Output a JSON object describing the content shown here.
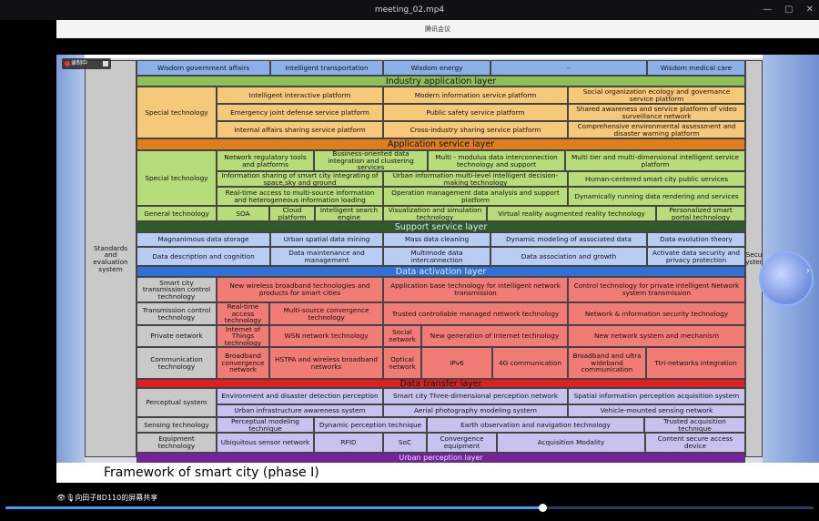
{
  "window": {
    "title": "meeting_02.mp4",
    "controls": [
      "—",
      "▢",
      "✕"
    ]
  },
  "meeting_bar": {
    "label": "腾讯会议"
  },
  "recording": {
    "label": "录制中"
  },
  "bottom": {
    "share_text": "👁🎙向田子BD110的屏幕共享"
  },
  "progress": {
    "value_fraction": 0.664
  },
  "caption": "Framework of smart city (phase I)",
  "colors": {
    "top_row": "#8ab0e8",
    "industry_layer": "#8ec05a",
    "industry_cell": "#f6c87a",
    "app_layer": "#e07e1d",
    "app_cell": "#b7dc7a",
    "support_layer": "#2f5a2a",
    "support_cell": "#b9cdf3",
    "activation_layer": "#2f71d5",
    "activation_cell": "#f07c75",
    "transfer_layer": "#e02020",
    "perception_cell": "#c7c3ee",
    "urban_layer": "#7a1fa0",
    "side_label": "#c9c9c9"
  },
  "slide": {
    "top_row": [
      "Wisdom government affairs",
      "Intelligent transportation",
      "Wisdom energy",
      "–",
      "Wisdom medical care"
    ],
    "side_label_left": "Standards and evaluation system",
    "side_label_right": "Secu system",
    "layers": {
      "industry": "Industry application layer",
      "app": "Application service layer",
      "support": "Support service layer",
      "activation": "Data activation layer",
      "transfer": "Data transfer layer",
      "urban": "Urban perception layer"
    },
    "industry": {
      "label": "Special technology",
      "rows": [
        [
          "Intelligent interactive platform",
          "Modern information service platform",
          "Social organization ecology and governance service platform"
        ],
        [
          "Emergency joint defense service platform",
          "Public safety service platform",
          "Shared awareness and service platform of video surveillance network"
        ],
        [
          "Internal affairs sharing service platform",
          "Cross-industry sharing service platform",
          "Comprehensive environmental assessment and disaster warning platform"
        ]
      ]
    },
    "app": {
      "special_label": "Special technology",
      "row1": [
        "Network regulatory tools and platforms",
        "Business-oriented data integration and clustering services",
        "Multi - modulus data interconnection technology and support",
        "Multi tier and multi-dimensional intelligent service platform"
      ],
      "row2": [
        "Information sharing of smart city integrating of space,sky and ground",
        "Urban information multi-level intelligent decision-making technology",
        "Human-centered smart city public services"
      ],
      "row3": [
        "Real-time access to multi-source information and heterogeneous information loading",
        "Operation management data analysis and support platform",
        "Dynamically running data rendering and services"
      ],
      "general_label": "General technology",
      "row4": [
        "SOA",
        "Cloud platform",
        "Intelligent search engine",
        "Visualization and simulation technology",
        "Virtual reality augmented reality technology",
        "Personalized smart portal technology"
      ]
    },
    "support": {
      "row1": [
        "Magnanimous data storage",
        "Urban spatial data mining",
        "Mass data cleaning",
        "Dynamic modeling of associated data",
        "Data evolution theory"
      ],
      "row2": [
        "Data description and cognition",
        "Data maintenance and management",
        "Multimode data interconnection",
        "Data association and growth",
        "Activate data security and privacy protection"
      ]
    },
    "activation": {
      "r1_label": "Smart city transmission control technology",
      "r1": [
        "New wireless broadband technologies and products for smart cities",
        "Application base technology for intelligent network transmission",
        "Control technology for private intelligent Network system transmission"
      ],
      "r2_label": "Transmission control technology",
      "r2": [
        "Real-time access technology",
        "Multi-source convergence technology",
        "Trusted controllable managed network technology",
        "Network & information security technology"
      ],
      "r3_label": "Private network",
      "r3": [
        "Internet of Things technology",
        "WSN network technology",
        "Social network",
        "New generation of Internet technology",
        "New network system and mechanism"
      ],
      "r4_label": "Communication technology",
      "r4": [
        "Broadband convergence network",
        "HSTPA and wireless broadband networks",
        "Optical network",
        "IPv6",
        "4G communication",
        "Broadband and ultra wideband communication",
        "Ttri-networks integration"
      ]
    },
    "perception": {
      "r1_label": "Perceptual system",
      "r1a": [
        "Environment and disaster detection perception",
        "Smart city Three-dimensional perception network",
        "Spatial information perception acquisition system"
      ],
      "r1b": [
        "Urban infrastructure awareness system",
        "Aerial photography modeling system",
        "Vehicle-mounted sensing network"
      ],
      "r2_label": "Sensing technology",
      "r2": [
        "Perceptual modeling technique",
        "Dynamic perception technique",
        "Earth observation and navigation technology",
        "Trusted acquisition technique"
      ],
      "r3_label": "Equipment technology",
      "r3": [
        "Ubiquitous sensor network",
        "RFID",
        "SoC",
        "Convergence equipment",
        "Acquisition Modality",
        "Content secure access device"
      ]
    }
  }
}
